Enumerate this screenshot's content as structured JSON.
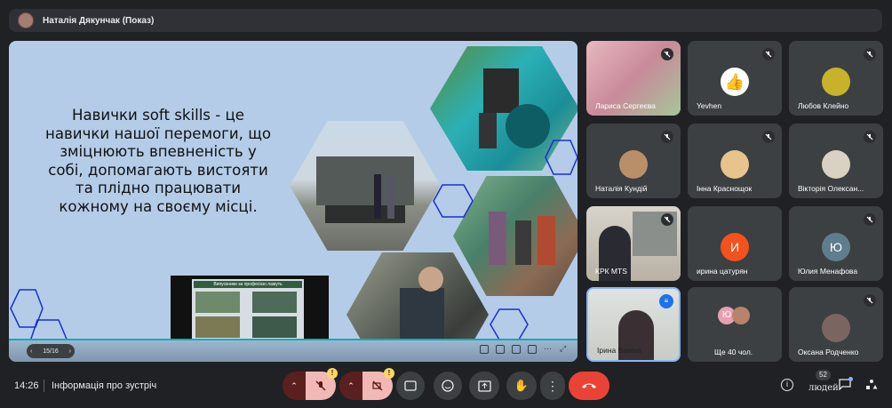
{
  "topbar": {
    "presenter_name": "Наталія Дякунчак (Показ)"
  },
  "slide": {
    "text": "Навички soft skills - це навички нашої перемоги, що зміцнюють впевненість у собі, допомагають вистояти та плідно працювати кожному на своєму місці.",
    "inner_screen_title": "Випускники за професією лажуть",
    "page_indicator": "15/16"
  },
  "participants": [
    {
      "name": "Лариса Сергеєва"
    },
    {
      "name": "Yevhen"
    },
    {
      "name": "Любов Клейно"
    },
    {
      "name": "Наталія Кундій"
    },
    {
      "name": "Інна Краснощок"
    },
    {
      "name": "Вікторія Олексан..."
    },
    {
      "name": "КРК МТS"
    },
    {
      "name": "ирина цатурян",
      "initial": "И"
    },
    {
      "name": "Юлия Менафова",
      "initial": "Ю"
    },
    {
      "name": "Ірина Ваніна"
    },
    {
      "name": "Ще 40 чол.",
      "initial": "Ю"
    },
    {
      "name": "Оксана Родченко"
    }
  ],
  "bottombar": {
    "time": "14:26",
    "meeting_info": "Інформація про зустріч",
    "people_count": "52",
    "people_label": "людей"
  },
  "colors": {
    "end_call": "#ea4335",
    "muted_btn": "#8a2b2b",
    "accent": "#8ab4f8"
  }
}
